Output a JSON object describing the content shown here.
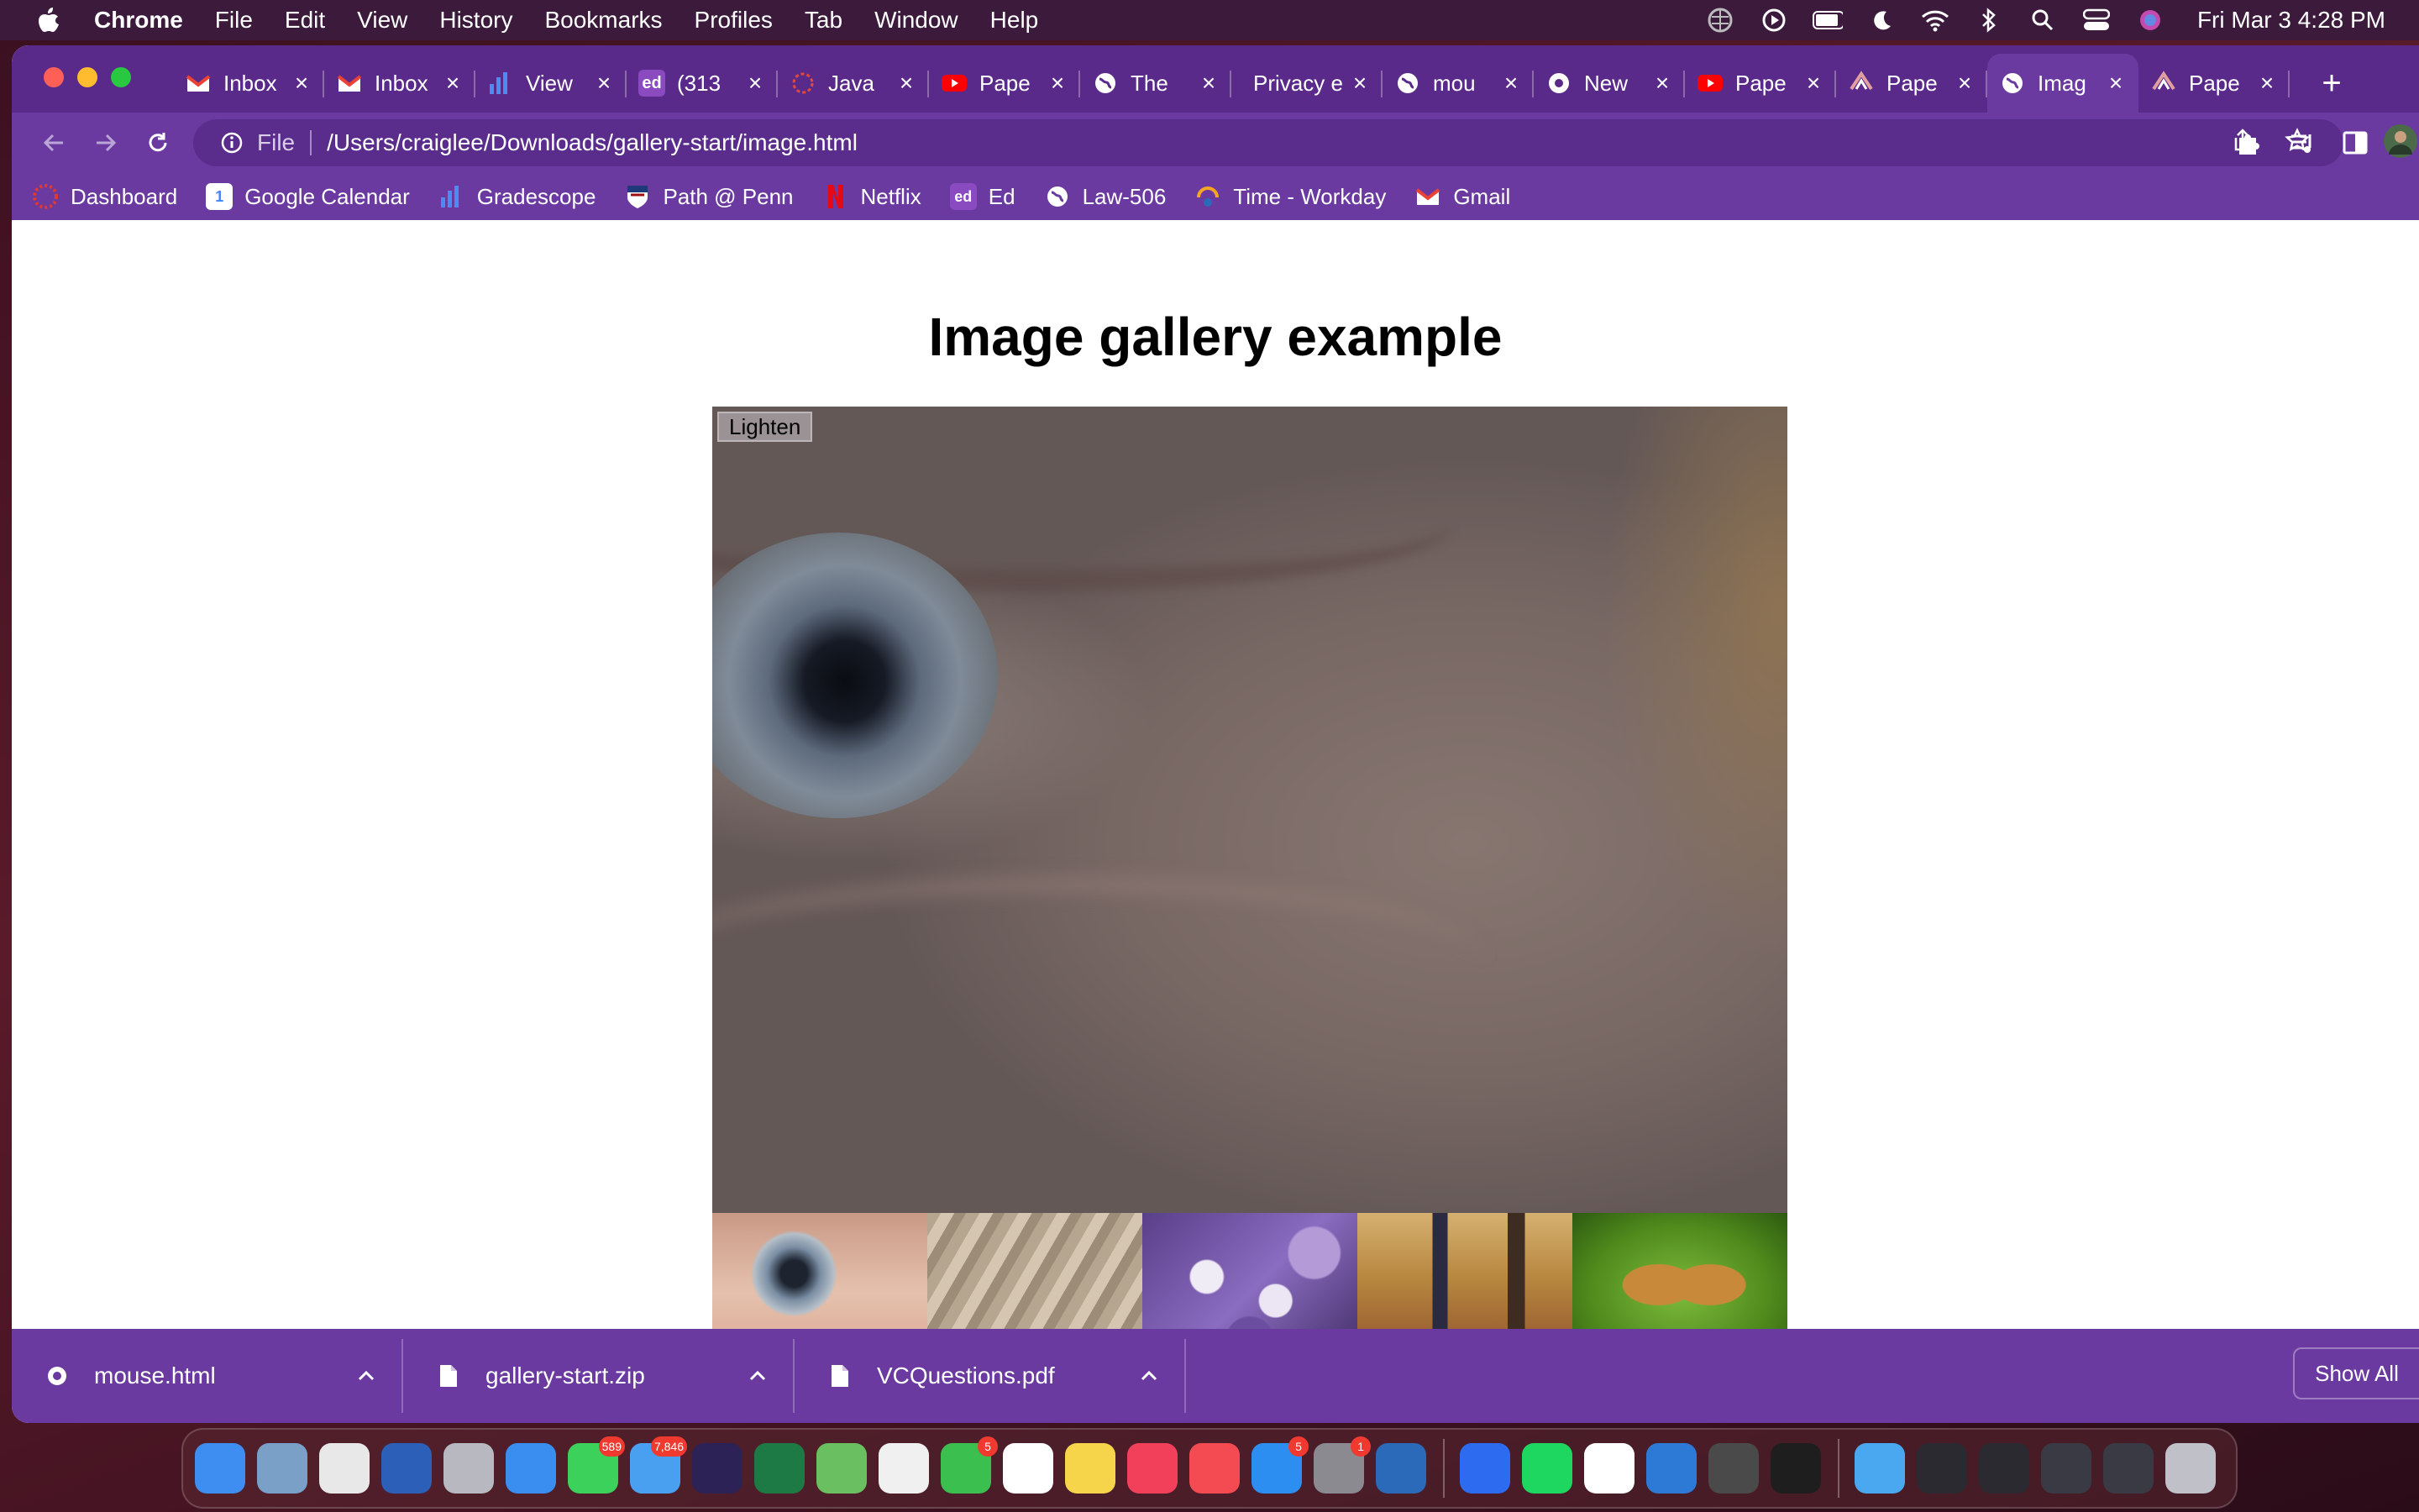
{
  "menubar": {
    "app_name": "Chrome",
    "items": [
      "File",
      "Edit",
      "View",
      "History",
      "Bookmarks",
      "Profiles",
      "Tab",
      "Window",
      "Help"
    ],
    "clock": "Fri Mar 3  4:28 PM",
    "status_icons": [
      "vpn-icon",
      "play-icon",
      "battery-icon",
      "moon-icon",
      "wifi-icon",
      "bluetooth-icon",
      "search-icon",
      "control-center-icon",
      "siri-icon"
    ]
  },
  "browser": {
    "tabs": [
      {
        "title": "Inbox",
        "icon": "gmail-icon",
        "active": false
      },
      {
        "title": "Inbox",
        "icon": "gmail-icon",
        "active": false
      },
      {
        "title": "View",
        "icon": "chart-icon",
        "active": false
      },
      {
        "title": "(313",
        "icon": "ed-icon",
        "active": false
      },
      {
        "title": "Java",
        "icon": "spinner-icon",
        "active": false
      },
      {
        "title": "Pape",
        "icon": "youtube-icon",
        "active": false
      },
      {
        "title": "The",
        "icon": "globe-icon",
        "active": false
      },
      {
        "title": "Privacy e",
        "icon": "",
        "active": false
      },
      {
        "title": "mou",
        "icon": "globe-icon",
        "active": false
      },
      {
        "title": "New",
        "icon": "chrome-icon",
        "active": false
      },
      {
        "title": "Pape",
        "icon": "youtube-icon",
        "active": false
      },
      {
        "title": "Pape",
        "icon": "penn-icon",
        "active": false
      },
      {
        "title": "Imag",
        "icon": "globe-icon",
        "active": true
      },
      {
        "title": "Pape",
        "icon": "penn-icon",
        "active": false
      }
    ],
    "new_tab_label": "+",
    "address": {
      "scheme": "File",
      "url": "/Users/craiglee/Downloads/gallery-start/image.html"
    },
    "bookmarks": [
      {
        "label": "Dashboard",
        "icon": "canvas-icon",
        "color": "#e4392b"
      },
      {
        "label": "Google Calendar",
        "icon": "calendar-icon",
        "color": "#4285f4"
      },
      {
        "label": "Gradescope",
        "icon": "bar-chart-icon",
        "color": "#4a8cf0"
      },
      {
        "label": "Path @ Penn",
        "icon": "penn-shield-icon",
        "color": "#1f3a7a"
      },
      {
        "label": "Netflix",
        "icon": "netflix-icon",
        "color": "#e50914"
      },
      {
        "label": "Ed",
        "icon": "ed-icon",
        "color": "#8a4ac0"
      },
      {
        "label": "Law-506",
        "icon": "globe-icon",
        "color": "#ffffff"
      },
      {
        "label": "Time - Workday",
        "icon": "workday-icon",
        "color": "#f5a623"
      },
      {
        "label": "Gmail",
        "icon": "gmail-icon",
        "color": "#ea4335"
      }
    ]
  },
  "page": {
    "title": "Image gallery example",
    "lighten_button": "Lighten",
    "thumbnails": [
      "eye-thumbnail",
      "rock-thumbnail",
      "flowers-thumbnail",
      "egyptian-art-thumbnail",
      "butterfly-thumbnail"
    ]
  },
  "downloads": {
    "items": [
      {
        "name": "mouse.html",
        "icon": "chrome-file-icon"
      },
      {
        "name": "gallery-start.zip",
        "icon": "file-icon"
      },
      {
        "name": "VCQuestions.pdf",
        "icon": "file-icon"
      }
    ],
    "show_all": "Show All"
  },
  "dock": {
    "apps": [
      {
        "name": "finder-icon",
        "color": "#3d8ef0",
        "badge": ""
      },
      {
        "name": "preview-icon",
        "color": "#7aa0c8",
        "badge": ""
      },
      {
        "name": "chrome-icon",
        "color": "#e8e8e8",
        "badge": ""
      },
      {
        "name": "word-icon",
        "color": "#2b5fb8",
        "badge": ""
      },
      {
        "name": "launchpad-icon",
        "color": "#b8b8c0",
        "badge": ""
      },
      {
        "name": "safari-icon",
        "color": "#3a8ef0",
        "badge": ""
      },
      {
        "name": "messages-icon",
        "color": "#3bd15b",
        "badge": "589"
      },
      {
        "name": "mail-icon",
        "color": "#4aa0f0",
        "badge": "7,846"
      },
      {
        "name": "eclipse-icon",
        "color": "#2c2255",
        "badge": ""
      },
      {
        "name": "excel-icon",
        "color": "#1e7a45",
        "badge": ""
      },
      {
        "name": "maps-icon",
        "color": "#6ac060",
        "badge": ""
      },
      {
        "name": "photos-icon",
        "color": "#f0f0f0",
        "badge": ""
      },
      {
        "name": "facetime-icon",
        "color": "#3bc050",
        "badge": "5"
      },
      {
        "name": "calendar-icon",
        "color": "#ffffff",
        "badge": ""
      },
      {
        "name": "notes-icon",
        "color": "#f7d54a",
        "badge": ""
      },
      {
        "name": "music-icon",
        "color": "#f2405a",
        "badge": ""
      },
      {
        "name": "news-icon",
        "color": "#f44a52",
        "badge": ""
      },
      {
        "name": "app-store-icon",
        "color": "#2c8ef0",
        "badge": "5"
      },
      {
        "name": "system-preferences-icon",
        "color": "#8a8a90",
        "badge": "1"
      },
      {
        "name": "flow-sports-icon",
        "color": "#2a6ab8",
        "badge": ""
      },
      {
        "name": "zoom-icon",
        "color": "#2d6cf0",
        "badge": ""
      },
      {
        "name": "spotify-icon",
        "color": "#1ed760",
        "badge": ""
      },
      {
        "name": "slack-icon",
        "color": "#ffffff",
        "badge": ""
      },
      {
        "name": "vscode-icon",
        "color": "#2c7ad6",
        "badge": ""
      },
      {
        "name": "sublime-icon",
        "color": "#4a4a4a",
        "badge": ""
      },
      {
        "name": "terminal-icon",
        "color": "#1e1e1e",
        "badge": ""
      },
      {
        "name": "folder-icon",
        "color": "#4aa8f0",
        "badge": ""
      },
      {
        "name": "window-preview-1-icon",
        "color": "#2a2a30",
        "badge": ""
      },
      {
        "name": "window-preview-2-icon",
        "color": "#2a2a30",
        "badge": ""
      },
      {
        "name": "window-preview-3-icon",
        "color": "#3a3a44",
        "badge": ""
      },
      {
        "name": "window-preview-4-icon",
        "color": "#3a3a44",
        "badge": ""
      },
      {
        "name": "trash-icon",
        "color": "#c0c0c8",
        "badge": ""
      }
    ]
  }
}
